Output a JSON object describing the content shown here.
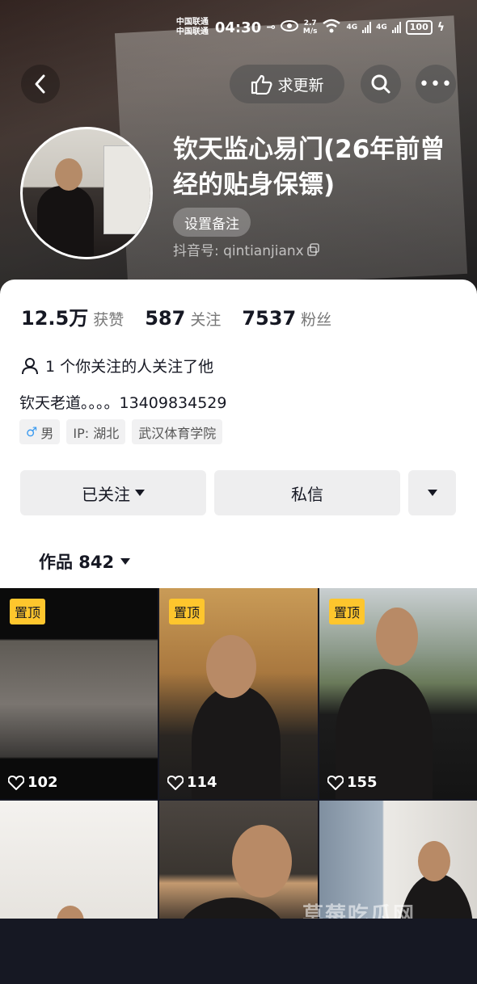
{
  "status_bar": {
    "carrier_1": "中国联通",
    "carrier_2": "中国联通",
    "time": "04:30",
    "speed_value": "2.7",
    "speed_unit": "M/s",
    "net_1": "4G",
    "net_2": "4G",
    "battery": "100"
  },
  "header": {
    "update_button": "求更新",
    "name": "钦天监心易门(26年前曾经的贴身保镖)",
    "remark_button": "设置备注",
    "douyin_id": "抖音号: qintianjianx"
  },
  "stats": [
    {
      "value": "12.5万",
      "label": "获赞"
    },
    {
      "value": "587",
      "label": "关注"
    },
    {
      "value": "7537",
      "label": "粉丝"
    }
  ],
  "mutual": "1 个你关注的人关注了他",
  "bio": "钦天老道。。。。13409834529",
  "tags": {
    "gender_symbol": "♂",
    "gender": "男",
    "ip": "IP: 湖北",
    "school": "武汉体育学院"
  },
  "actions": {
    "follow": "已关注",
    "message": "私信"
  },
  "works_tab": "作品 842",
  "videos": [
    {
      "pinned": "置顶",
      "likes": "102"
    },
    {
      "pinned": "置顶",
      "likes": "114"
    },
    {
      "pinned": "置顶",
      "likes": "155"
    },
    {
      "pinned": "",
      "likes": ""
    },
    {
      "pinned": "",
      "likes": ""
    },
    {
      "pinned": "",
      "likes": ""
    }
  ],
  "watermark": "草莓吃瓜网",
  "colors": {
    "pin_badge": "#fec62d",
    "text_primary": "#161823",
    "male_icon": "#3c9bf0"
  }
}
